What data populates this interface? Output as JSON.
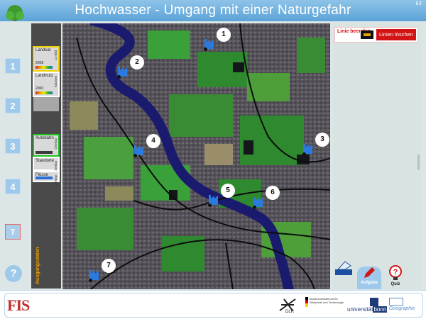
{
  "app": {
    "title": "Hochwasser - Umgang mit einer Naturgefahr",
    "corner_label": "83"
  },
  "nav": {
    "buttons": [
      "1",
      "2",
      "3",
      "4"
    ],
    "text_button": "T",
    "help_button": "?"
  },
  "layers": {
    "items": [
      {
        "label": "Landsat",
        "year": "2008",
        "side": "Lu-Bild",
        "state": "active"
      },
      {
        "label": "Landnutz",
        "year": "2000",
        "side": "Klassen",
        "state": "inactive"
      },
      {
        "label": "Autobahn",
        "year": "",
        "side": "Overlay",
        "state": "active-green"
      },
      {
        "label": "Standorte",
        "year": "",
        "side": "Overlay",
        "state": "inactive"
      },
      {
        "label": "Flüsse",
        "year": "",
        "side": "Overlay",
        "state": "inactive"
      }
    ],
    "footer_label": "Ausgangsdaten"
  },
  "map": {
    "pois": [
      "1",
      "2",
      "3",
      "4",
      "5",
      "6",
      "7"
    ],
    "icon": "factory-icon"
  },
  "right_panel": {
    "linie_beenden": "Linie beenden",
    "linien_loeschen": "Linien löschen"
  },
  "bottom_tabs": {
    "aufgabe": "Aufgabe",
    "quiz": "Quiz"
  },
  "footer": {
    "logo_fis": "FIS",
    "dlr": "DLR",
    "bmwi": "Bundesministerium für Wirtschaft und Technologie",
    "uni": "universität",
    "uni_highlight": "bonn",
    "geo": "Geographie"
  },
  "colors": {
    "accent": "#5aa3d8",
    "nav_button": "#9ec9ea",
    "red": "#d31414",
    "river": "#1a1a6e"
  }
}
